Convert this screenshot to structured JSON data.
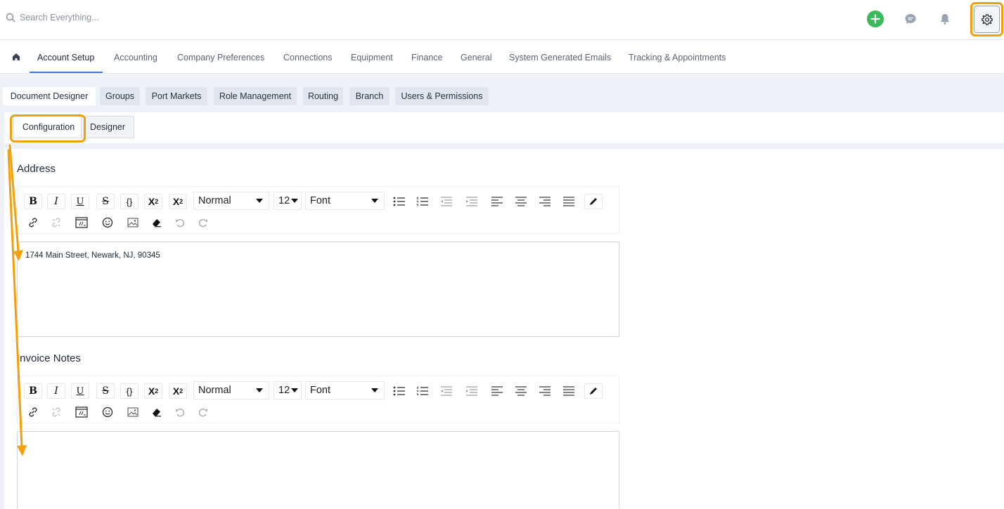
{
  "search": {
    "placeholder": "Search Everything..."
  },
  "header_icons": [
    "add-icon",
    "chat-icon",
    "bell-icon",
    "gear-icon"
  ],
  "main_nav": {
    "items": [
      "Account Setup",
      "Accounting",
      "Company Preferences",
      "Connections",
      "Equipment",
      "Finance",
      "General",
      "System Generated Emails",
      "Tracking & Appointments"
    ],
    "active": "Account Setup"
  },
  "sub_tabs": {
    "items": [
      "Document Designer",
      "Groups",
      "Port Markets",
      "Role Management",
      "Routing",
      "Branch",
      "Users & Permissions"
    ],
    "active": "Document Designer"
  },
  "inner_tabs": {
    "items": [
      "Configuration",
      "Designer"
    ],
    "active": "Configuration"
  },
  "toolbar": {
    "bold": "B",
    "italic": "I",
    "underline": "U",
    "strike": "S",
    "code": "{}",
    "superscript_base": "X",
    "superscript_mark": "2",
    "subscript_base": "X",
    "subscript_mark": "2",
    "format_value": "Normal",
    "size_value": "12",
    "font_value": "Font"
  },
  "sections": [
    {
      "title": "Address",
      "content": "1744 Main Street, Newark, NJ, 90345"
    },
    {
      "title": "Invoice Notes",
      "content": ""
    }
  ],
  "colors": {
    "accent": "#2f7de1",
    "highlight": "#f5a00a",
    "add_green": "#3cb95a",
    "band": "#eef1f6"
  }
}
